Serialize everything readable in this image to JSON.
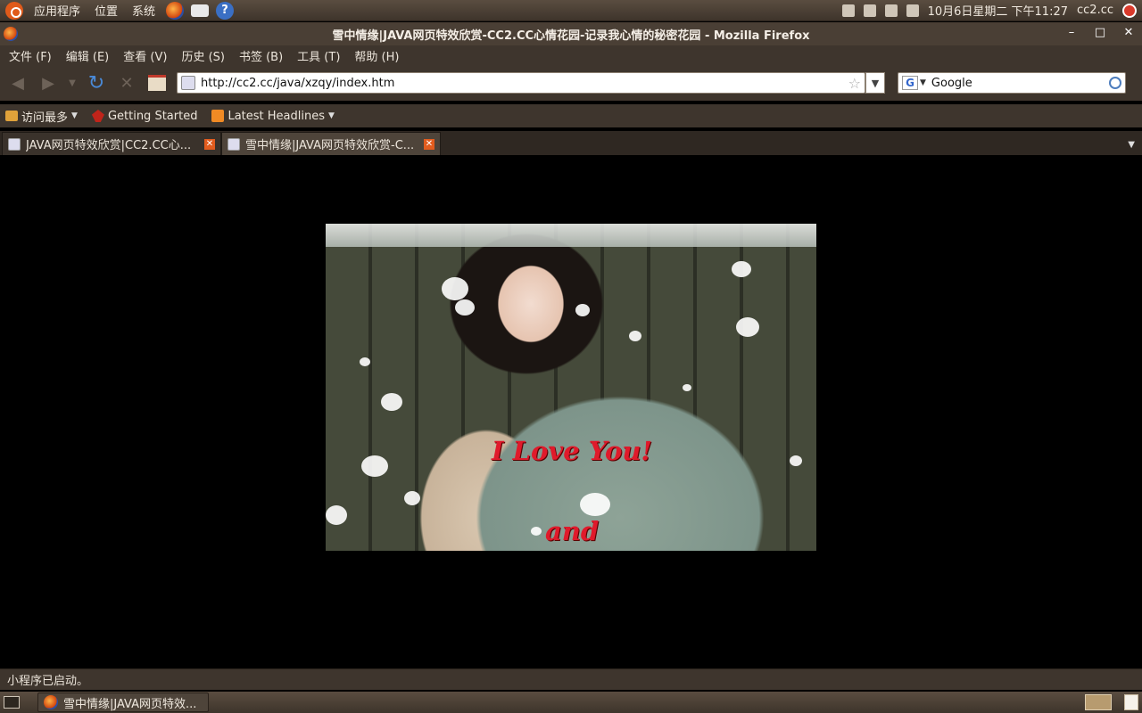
{
  "top_panel": {
    "menus": [
      "应用程序",
      "位置",
      "系统"
    ],
    "clock": "10月6日星期二 下午11:27",
    "user": "cc2.cc"
  },
  "window": {
    "title": "雪中情缘|JAVA网页特效欣赏-CC2.CC心情花园-记录我心情的秘密花园 - Mozilla Firefox"
  },
  "menubar": {
    "items": [
      "文件 (F)",
      "编辑 (E)",
      "查看 (V)",
      "历史 (S)",
      "书签 (B)",
      "工具 (T)",
      "帮助 (H)"
    ]
  },
  "navbar": {
    "url": "http://cc2.cc/java/xzqy/index.htm",
    "search_engine": "Google",
    "search_value": "Google"
  },
  "bookmarks": {
    "items": [
      {
        "label": "访问最多",
        "icon": "folder-icon"
      },
      {
        "label": "Getting Started",
        "icon": "getting-started-icon"
      },
      {
        "label": "Latest Headlines",
        "icon": "rss-icon"
      }
    ]
  },
  "tabs": [
    {
      "label": "JAVA网页特效欣赏|CC2.CC心...",
      "active": false
    },
    {
      "label": "雪中情缘|JAVA网页特效欣赏-C...",
      "active": true
    }
  ],
  "content": {
    "caption_line1": "I Love You!",
    "caption_line2": "and"
  },
  "statusbar": {
    "text": "小程序已启动。"
  },
  "taskbar": {
    "task_label": "雪中情缘|JAVA网页特效..."
  },
  "colors": {
    "caption": "#e01a2b",
    "panel": "#3e352d",
    "accent": "#e25c1e"
  }
}
